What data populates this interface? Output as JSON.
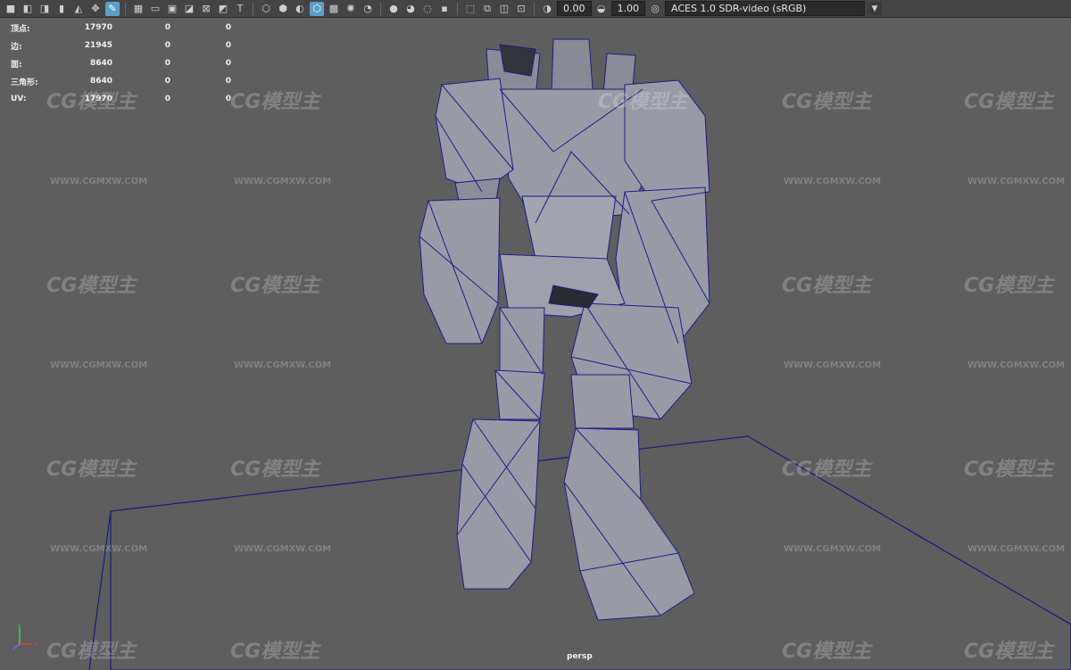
{
  "toolbar": {
    "exposure_value": "0.00",
    "gamma_value": "1.00",
    "colorspace": "ACES 1.0 SDR-video (sRGB)",
    "icons": [
      "camera-icon",
      "camera-attr-icon",
      "bookmark-icon",
      "image-plane-icon",
      "grid-icon",
      "film-gate-icon",
      "resolution-gate-icon",
      "gate-mask-icon",
      "field-chart-icon",
      "safe-action-icon",
      "safe-title-icon",
      "wireframe-icon",
      "smooth-shade-icon",
      "default-material-icon",
      "wireframe-on-shaded-icon",
      "xray-icon",
      "use-lights-icon",
      "shadows-icon",
      "screen-ao-icon",
      "motion-blur-icon",
      "aa-icon",
      "isolate-icon",
      "xray-joints-icon",
      "exposure-icon",
      "gamma-icon",
      "color-mgmt-icon"
    ]
  },
  "hud": {
    "rows": [
      {
        "label": "顶点:",
        "v1": "17970",
        "v2": "0",
        "v3": "0"
      },
      {
        "label": "边:",
        "v1": "21945",
        "v2": "0",
        "v3": "0"
      },
      {
        "label": "面:",
        "v1": "8640",
        "v2": "0",
        "v3": "0"
      },
      {
        "label": "三角形:",
        "v1": "8640",
        "v2": "0",
        "v3": "0"
      },
      {
        "label": "UV:",
        "v1": "17970",
        "v2": "0",
        "v3": "0"
      }
    ]
  },
  "viewport": {
    "camera": "persp"
  },
  "axis": {
    "x": "x",
    "y": "y",
    "z": "z"
  },
  "watermark": {
    "logo": "CG模型主",
    "url": "WWW.CGMXW.COM"
  },
  "colors": {
    "viewport_bg": "#5e5e5e",
    "wire": "#1c1c8c",
    "model_fill": "#9a9aa6",
    "accent": "#5ba0c8"
  }
}
